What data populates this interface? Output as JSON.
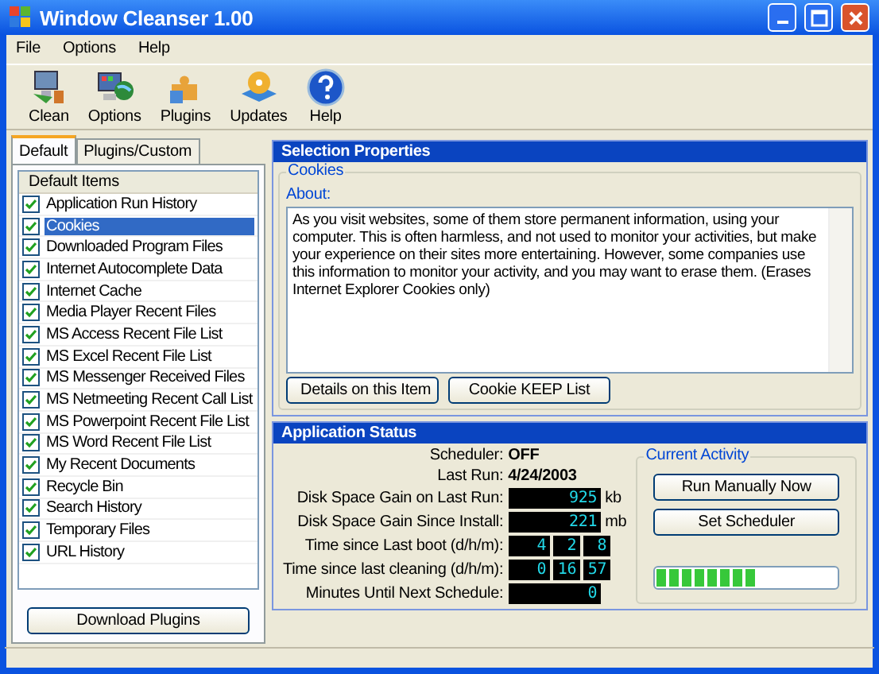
{
  "window": {
    "title": "Window Cleanser 1.00"
  },
  "menu": [
    "File",
    "Options",
    "Help"
  ],
  "toolbar": [
    {
      "kind": "clean",
      "label": "Clean"
    },
    {
      "kind": "options",
      "label": "Options"
    },
    {
      "kind": "plugins",
      "label": "Plugins"
    },
    {
      "kind": "updates",
      "label": "Updates"
    },
    {
      "kind": "help",
      "label": "Help"
    }
  ],
  "tabs": [
    {
      "label": "Default",
      "selected": true
    },
    {
      "label": "Plugins/Custom",
      "selected": false
    }
  ],
  "items_header": "Default Items",
  "items": [
    {
      "label": "Application Run History",
      "checked": true,
      "selected": false
    },
    {
      "label": "Cookies",
      "checked": true,
      "selected": true
    },
    {
      "label": "Downloaded Program Files",
      "checked": true,
      "selected": false
    },
    {
      "label": "Internet Autocomplete Data",
      "checked": true,
      "selected": false
    },
    {
      "label": "Internet Cache",
      "checked": true,
      "selected": false
    },
    {
      "label": "Media Player Recent Files",
      "checked": true,
      "selected": false
    },
    {
      "label": "MS Access Recent File List",
      "checked": true,
      "selected": false
    },
    {
      "label": "MS Excel Recent File List",
      "checked": true,
      "selected": false
    },
    {
      "label": "MS Messenger Received Files",
      "checked": true,
      "selected": false
    },
    {
      "label": "MS Netmeeting Recent Call List",
      "checked": true,
      "selected": false
    },
    {
      "label": "MS Powerpoint Recent File List",
      "checked": true,
      "selected": false
    },
    {
      "label": "MS Word Recent File List",
      "checked": true,
      "selected": false
    },
    {
      "label": "My Recent Documents",
      "checked": true,
      "selected": false
    },
    {
      "label": "Recycle Bin",
      "checked": true,
      "selected": false
    },
    {
      "label": "Search History",
      "checked": true,
      "selected": false
    },
    {
      "label": "Temporary Files",
      "checked": true,
      "selected": false
    },
    {
      "label": "URL History",
      "checked": true,
      "selected": false
    }
  ],
  "download_button": "Download Plugins",
  "selection": {
    "header": "Selection Properties",
    "group": "Cookies",
    "about_label": "About:",
    "about": "As you visit websites, some of them store permanent information, using your computer.  This is often harmless, and not used to monitor your activities, but make your experience on their sites more entertaining.  However, some companies use this information to monitor your activity, and you may want to erase them. (Erases Internet Explorer Cookies only)",
    "buttons": [
      "Details on this Item",
      "Cookie KEEP List"
    ]
  },
  "status": {
    "header": "Application Status",
    "rows": [
      {
        "kind": "text",
        "label": "Scheduler:",
        "value": "OFF"
      },
      {
        "kind": "text",
        "label": "Last Run:",
        "value": "4/24/2003"
      },
      {
        "kind": "lcd",
        "label": "Disk Space Gain on Last Run:",
        "digits": [
          "925"
        ],
        "unit": "kb"
      },
      {
        "kind": "lcd",
        "label": "Disk Space Gain Since Install:",
        "digits": [
          "221"
        ],
        "unit": "mb"
      },
      {
        "kind": "lcd3",
        "label": "Time since Last boot (d/h/m):",
        "digits": [
          "4",
          "2",
          "8"
        ]
      },
      {
        "kind": "lcd3",
        "label": "Time since last cleaning (d/h/m):",
        "digits": [
          "0",
          "16",
          "57"
        ]
      },
      {
        "kind": "lcd",
        "label": "Minutes Until Next Schedule:",
        "digits": [
          "0"
        ]
      }
    ],
    "activity": {
      "title": "Current Activity",
      "buttons": [
        "Run Manually Now",
        "Set Scheduler"
      ],
      "level": 0.56
    }
  }
}
